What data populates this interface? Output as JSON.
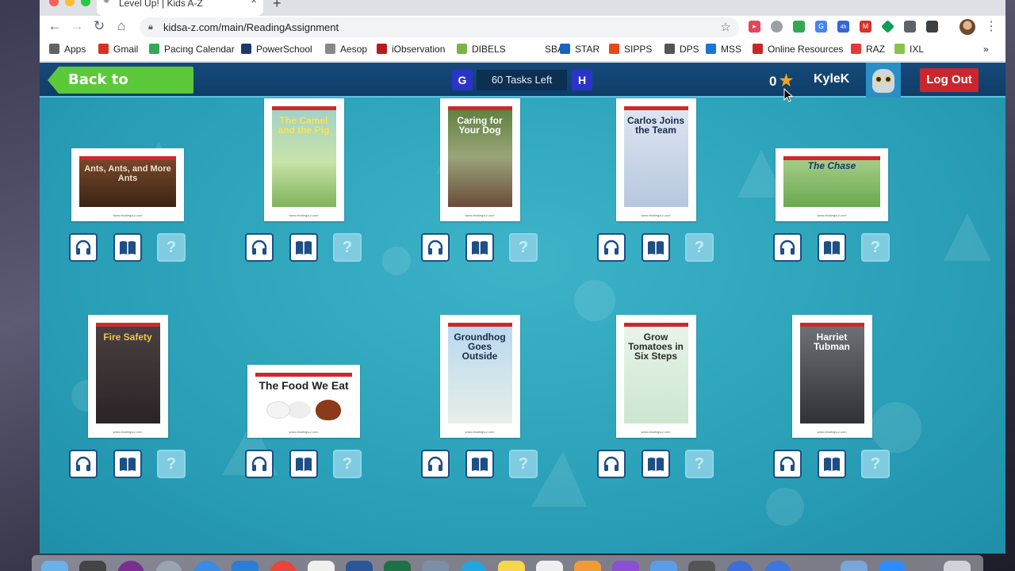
{
  "browser": {
    "tab_title": "Level Up! | Kids A-Z",
    "url": "kidsa-z.com/main/ReadingAssignment",
    "extension_badge": "4h",
    "bookmarks": [
      {
        "label": "Apps",
        "icon": "apps-grid-icon",
        "color": "#5f6368"
      },
      {
        "label": "Gmail",
        "icon": "gmail-icon",
        "color": "#d93025"
      },
      {
        "label": "Pacing Calendar",
        "icon": "calendar-plus-icon",
        "color": "#34a853"
      },
      {
        "label": "PowerSchool",
        "icon": "powerschool-icon",
        "color": "#1a3a6b"
      },
      {
        "label": "Aesop",
        "icon": "aesop-icon",
        "color": "#888888"
      },
      {
        "label": "iObservation",
        "icon": "iobservation-icon",
        "color": "#b71c1c"
      },
      {
        "label": "DIBELS",
        "icon": "dibels-icon",
        "color": "#7cb342"
      },
      {
        "label": "SBA",
        "icon": "sba-icon",
        "color": "#ffffff"
      },
      {
        "label": "STAR",
        "icon": "star-r-icon",
        "color": "#1565c0"
      },
      {
        "label": "SIPPS",
        "icon": "sipps-icon",
        "color": "#e64a19"
      },
      {
        "label": "DPS",
        "icon": "dps-icon",
        "color": "#555555"
      },
      {
        "label": "MSS",
        "icon": "mss-icon",
        "color": "#1976d2"
      },
      {
        "label": "Online Resources",
        "icon": "online-resources-icon",
        "color": "#c62828"
      },
      {
        "label": "RAZ",
        "icon": "raz-icon",
        "color": "#e53935"
      },
      {
        "label": "IXL",
        "icon": "ixl-icon",
        "color": "#8bc34a"
      }
    ]
  },
  "header": {
    "back_label": "Back to Reading",
    "level_current": "G",
    "level_next": "H",
    "tasks_left": "60 Tasks Left",
    "stars_count": "0",
    "username": "KyleK",
    "logout_label": "Log Out"
  },
  "colors": {
    "page_bg": "#2aa0b8",
    "header_bg": "#0f3d68",
    "back_green": "#5cc93b",
    "logout_red": "#c9272d",
    "level_blue": "#2a34c9",
    "star_orange": "#f5a623"
  },
  "books": [
    {
      "title": "Ants, Ants, and More Ants",
      "orientation": "landscape",
      "art": "ants"
    },
    {
      "title": "The Camel and the Pig",
      "orientation": "portrait",
      "art": "camel"
    },
    {
      "title": "Caring for Your Dog",
      "orientation": "portrait",
      "art": "dog"
    },
    {
      "title": "Carlos Joins the Team",
      "orientation": "portrait",
      "art": "carlos"
    },
    {
      "title": "The Chase",
      "orientation": "landscape",
      "art": "chase"
    },
    {
      "title": "Fire Safety",
      "orientation": "portrait",
      "art": "fire"
    },
    {
      "title": "The Food We Eat",
      "orientation": "landscape",
      "art": "food"
    },
    {
      "title": "Groundhog Goes Outside",
      "orientation": "portrait",
      "art": "groundhog"
    },
    {
      "title": "Grow Tomatoes in Six Steps",
      "orientation": "portrait",
      "art": "tomatoes"
    },
    {
      "title": "Harriet Tubman",
      "orientation": "portrait",
      "art": "harriet"
    }
  ],
  "book_footer": "www.readinga-z.com",
  "quiz_glyph": "?"
}
